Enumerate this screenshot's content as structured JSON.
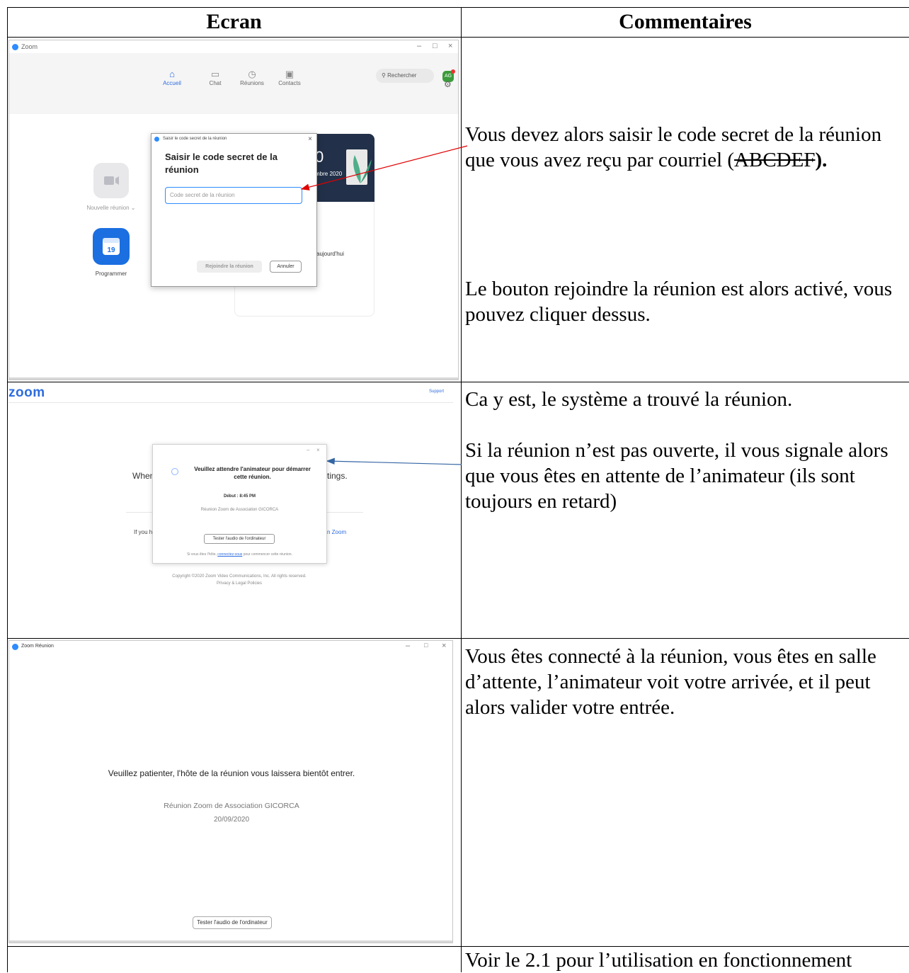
{
  "table": {
    "col_screen": "Ecran",
    "col_comments": "Commentaires"
  },
  "row1": {
    "window_title": "Zoom",
    "nav": [
      "Accueil",
      "Chat",
      "Réunions",
      "Contacts"
    ],
    "search_placeholder": "Rechercher",
    "avatar_initials": "AG",
    "tile_new_meeting": "Nouvelle réunion",
    "tile_schedule": "Programmer",
    "calendar_day": "19",
    "card_big_digit": "0",
    "card_date_partial": "mbre 2020",
    "card_today_partial": "aujourd'hui",
    "dialog_title": "Saisir le code secret de la réunion",
    "dialog_heading": "Saisir le code secret de la réunion",
    "dialog_placeholder": "Code secret de la réunion",
    "btn_join": "Rejoindre la réunion",
    "btn_cancel": "Annuler",
    "comment_line1": "Vous devez alors saisir le code secret de la réunion que vous avez reçu par courriel (",
    "comment_code": "ABCDEF",
    "comment_close": ").",
    "comment2": "Le bouton rejoindre la réunion est alors activé, vous pouvez cliquer dessus."
  },
  "row2": {
    "logo": "zoom",
    "support": "Support",
    "behind_when": "When",
    "behind_tings": "tings.",
    "behind_ifyou": "If you h",
    "behind_zoom": "n Zoom",
    "dialog_message": "Veuillez attendre l'animateur pour démarrer cette réunion.",
    "start_time": "Début : 8:45 PM",
    "meeting_name": "Réunion Zoom de Association GICORCA",
    "test_audio": "Tester l'audio de l'ordinateur",
    "host_prefix": "Si vous êtes l'hôte,",
    "host_link": "connectez-vous",
    "host_suffix": "pour commencer cette réunion.",
    "copyright": "Copyright ©2020 Zoom Video Communications, Inc. All rights reserved.",
    "privacy": "Privacy & Legal Policies",
    "comment1": "Ca y est, le système a trouvé la réunion.",
    "comment2": "Si la réunion n’est pas ouverte, il vous signale alors que vous êtes en attente de l’animateur (ils sont toujours en retard)"
  },
  "row3": {
    "window_title": "Zoom Réunion",
    "wait_message": "Veuillez patienter, l'hôte de la réunion vous laissera bientôt entrer.",
    "meeting_name": "Réunion Zoom de Association GICORCA",
    "date": "20/09/2020",
    "test_audio": "Tester l'audio de l'ordinateur",
    "comment": "Vous êtes connecté à la réunion, vous êtes en salle d’attente, l’animateur voit votre arrivée, et il peut alors valider votre entrée."
  },
  "row4": {
    "comment": "Voir le 2.1 pour l’utilisation en fonctionnement"
  },
  "colors": {
    "zoom_blue": "#2d8cff",
    "arrow_red": "#e00000",
    "arrow_blue": "#3465a4"
  }
}
